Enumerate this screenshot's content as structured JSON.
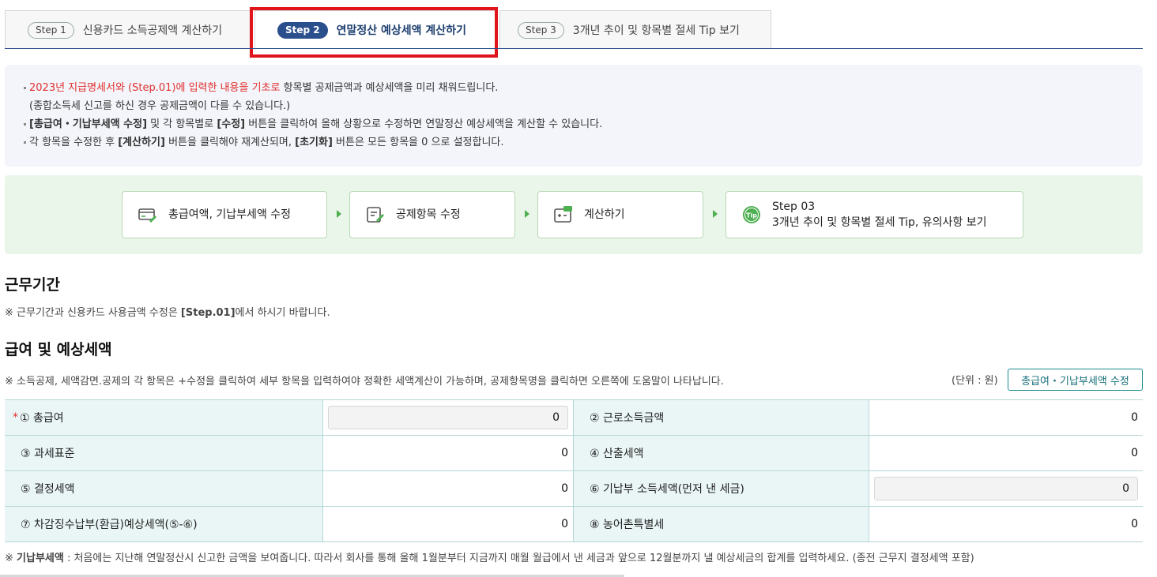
{
  "tabs": [
    {
      "pill": "Step 1",
      "label": "신용카드 소득공제액 계산하기"
    },
    {
      "pill": "Step 2",
      "label": "연말정산 예상세액 계산하기"
    },
    {
      "pill": "Step 3",
      "label": "3개년 추이 및 항목별 절세 Tip 보기"
    }
  ],
  "notice": {
    "line1_red": "2023년 지급명세서와 (Step.01)에 입력한 내용을 기초로",
    "line1_rest": " 항목별 공제금액과 예상세액을 미리 채워드립니다.",
    "line1_cont": "(종합소득세 신고를 하신 경우 공제금액이 다를 수 있습니다.)",
    "line2_b1": "[총급여・기납부세액 수정]",
    "line2_t1": " 및 각 항목별로 ",
    "line2_b2": "[수정]",
    "line2_t2": " 버튼을 클릭하여 올해 상황으로 수정하면 연말정산 예상세액을 계산할 수 있습니다.",
    "line3_t1": "각 항목을 수정한 후 ",
    "line3_b1": "[계산하기]",
    "line3_t2": " 버튼을 클릭해야 재계산되며, ",
    "line3_b2": "[초기화]",
    "line3_t3": " 버튼은 모든 항목을 0 으로 설정합니다."
  },
  "flow": {
    "step1": "총급여액, 기납부세액 수정",
    "step2": "공제항목 수정",
    "step3": "계산하기",
    "step4_line1": "Step 03",
    "step4_line2": "3개년 추이 및 항목별 절세 Tip, 유의사항 보기",
    "tip_badge": "Tip"
  },
  "work_period": {
    "title": "근무기간",
    "note_prefix": "※ 근무기간과 신용카드 사용금액 수정은 ",
    "note_bold": "[Step.01]",
    "note_suffix": "에서 하시기 바랍니다."
  },
  "salary": {
    "title": "급여 및 예상세액",
    "note": "※ 소득공제, 세액감면.공제의 각 항목은 +수정을 클릭하여 세부 항목을 입력하여야 정확한 세액계산이 가능하며, 공제항목명을 클릭하면 오른쪽에 도움말이 나타납니다.",
    "unit": "(단위 : 원)",
    "edit_button": "총급여・기납부세액 수정",
    "star": "*",
    "rows": [
      {
        "l1": "① 총급여",
        "v1": "0",
        "l2": "② 근로소득금액",
        "v2": "0"
      },
      {
        "l1": "③ 과세표준",
        "v1": "0",
        "l2": "④ 산출세액",
        "v2": "0"
      },
      {
        "l1": "⑤ 결정세액",
        "v1": "0",
        "l2": "⑥ 기납부 소득세액(먼저 낸 세금)",
        "v2": "0"
      },
      {
        "l1": "⑦ 차감징수납부(환급)예상세액(⑤-⑥)",
        "v1": "0",
        "l2": "⑧ 농어촌특별세",
        "v2": "0"
      }
    ],
    "footnote_prefix": "※ ",
    "footnote_bold": "기납부세액",
    "footnote_rest": " : 처음에는 지난해 연말정산시 신고한 금액을 보여줍니다. 따라서 회사를 통해 올해 1월분부터 지금까지 매월 월급에서 낸 세금과 앞으로 12월분까지 낼 예상세금의 합계를 입력하세요. (종전 근무지 결정세액 포함)"
  },
  "colors": {
    "accent_blue": "#2b4f8c",
    "highlight_red": "#e0151b",
    "teal": "#1a8a8e",
    "flow_bg": "#ebf6ea"
  }
}
